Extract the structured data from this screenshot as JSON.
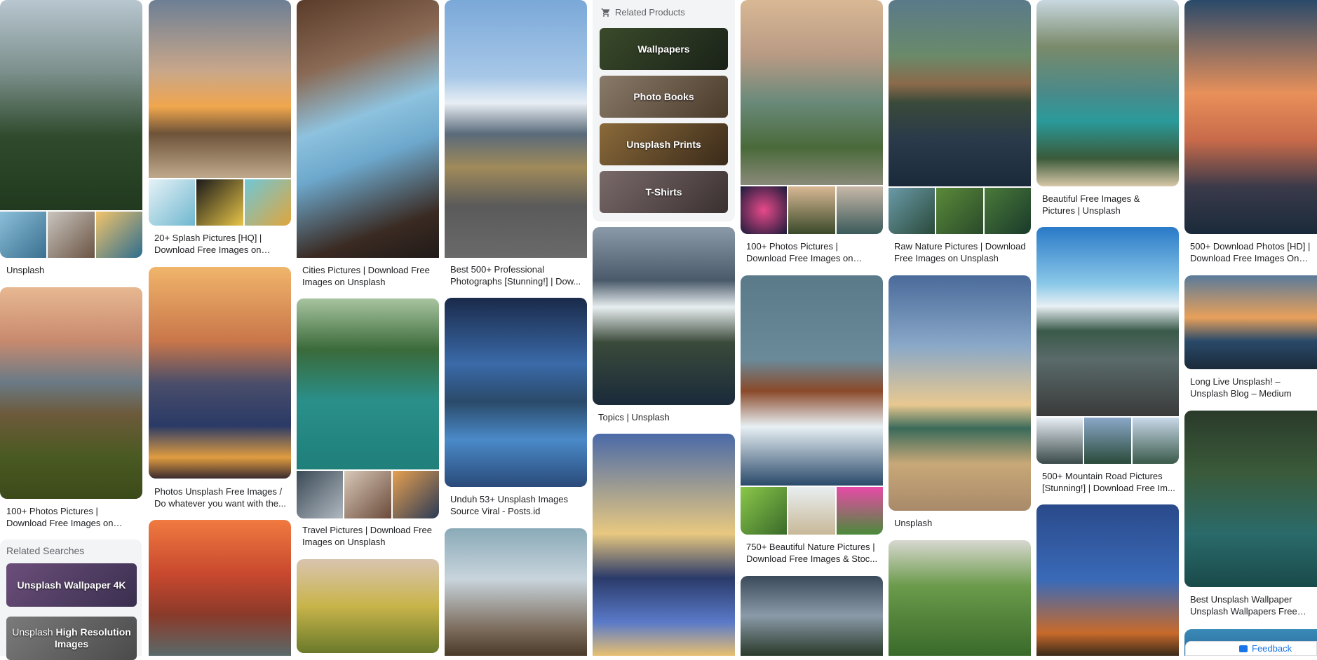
{
  "results": {
    "col1": [
      {
        "caption": "Unsplash"
      },
      {
        "caption": "100+ Photos Pictures | Download Free Images on Uns..."
      }
    ],
    "col2": [
      {
        "caption": "20+ Splash Pictures [HQ] | Download Free Images on Uns..."
      },
      {
        "caption": "Photos Unsplash Free Images / Do whatever you want with the..."
      }
    ],
    "col3": [
      {
        "caption": "Cities Pictures | Download Free Images on Unsplash"
      },
      {
        "caption": "Travel Pictures | Download Free Images on Unsplash"
      }
    ],
    "col4": [
      {
        "caption": "Best 500+ Professional Photographs [Stunning!] | Dow..."
      },
      {
        "caption": "Unduh 53+ Unsplash Images Source Viral - Posts.id"
      }
    ],
    "col5": [
      {
        "caption": "Topics | Unsplash"
      }
    ],
    "col6": [
      {
        "caption": "100+ Photos Pictures | Download Free Images on Uns..."
      },
      {
        "caption": "750+ Beautiful Nature Pictures | Download Free Images & Stoc..."
      }
    ],
    "col7": [
      {
        "caption": "Raw Nature Pictures | Download Free Images on Unsplash"
      },
      {
        "caption": "Unsplash"
      }
    ],
    "col8": [
      {
        "caption": "Beautiful Free Images & Pictures | Unsplash"
      },
      {
        "caption": "500+ Mountain Road Pictures [Stunning!] | Download Free Im..."
      }
    ],
    "col9": [
      {
        "caption": "500+ Download Photos [HD] | Download Free Images On Un..."
      },
      {
        "caption": "Long Live Unsplash! – Unsplash Blog – Medium"
      },
      {
        "caption": "Best Unsplash Wallpaper Unsplash Wallpapers Free Do..."
      }
    ]
  },
  "related_products": {
    "title": "Related Products",
    "items": [
      "Wallpapers",
      "Photo Books",
      "Unsplash Prints",
      "T-Shirts"
    ]
  },
  "related_searches": {
    "title": "Related Searches",
    "items": [
      {
        "label": "Unsplash Wallpaper 4K"
      },
      {
        "prefix": "Unsplash ",
        "bold": "High Resolution Images"
      }
    ]
  },
  "feedback": {
    "label": "Feedback"
  },
  "icons": {
    "cart": "shopping-cart-icon",
    "feedback": "feedback-icon"
  },
  "colors": {
    "link": "#1a73e8",
    "panel_bg": "#f3f4f6",
    "caption": "#202124"
  }
}
